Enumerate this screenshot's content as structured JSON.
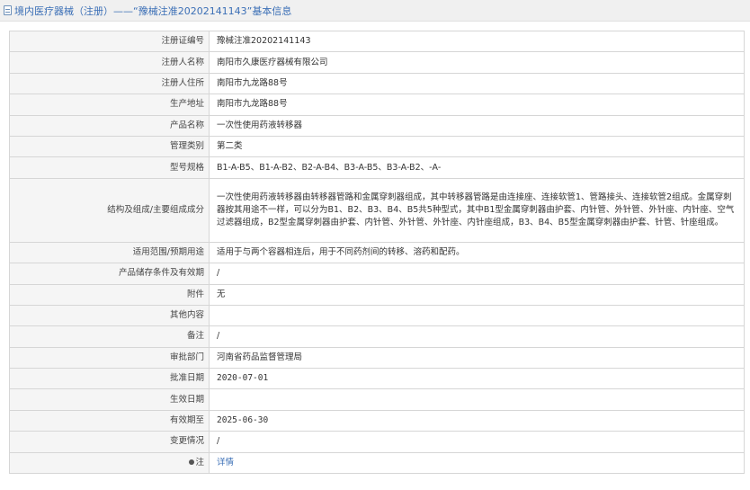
{
  "header": {
    "title": "境内医疗器械（注册）——“豫械注准20202141143”基本信息"
  },
  "rows": [
    {
      "label": "注册证编号",
      "value": "豫械注准20202141143"
    },
    {
      "label": "注册人名称",
      "value": "南阳市久康医疗器械有限公司"
    },
    {
      "label": "注册人住所",
      "value": "南阳市九龙路88号"
    },
    {
      "label": "生产地址",
      "value": "南阳市九龙路88号"
    },
    {
      "label": "产品名称",
      "value": "一次性使用药液转移器"
    },
    {
      "label": "管理类别",
      "value": "第二类"
    },
    {
      "label": "型号规格",
      "value": "B1-A-B5、B1-A-B2、B2-A-B4、B3-A-B5、B3-A-B2、-A-"
    },
    {
      "label": "结构及组成/主要组成成分",
      "value": "一次性使用药液转移器由转移器管路和金属穿刺器组成，其中转移器管路是由连接座、连接软管1、管路接头、连接软管2组成。金属穿刺器按其用途不一样，可以分为B1、B2、B3、B4、B5共5种型式，其中B1型金属穿刺器由护套、内针管、外针管、外针座、内针座、空气过滤器组成，B2型金属穿刺器由护套、内针管、外针管、外针座、内针座组成，B3、B4、B5型金属穿刺器由护套、针管、针座组成。"
    },
    {
      "label": "适用范围/预期用途",
      "value": "适用于与两个容器相连后，用于不同药剂间的转移、溶药和配药。"
    },
    {
      "label": "产品储存条件及有效期",
      "value": "/"
    },
    {
      "label": "附件",
      "value": "无"
    },
    {
      "label": "其他内容",
      "value": ""
    },
    {
      "label": "备注",
      "value": "/"
    },
    {
      "label": "审批部门",
      "value": "河南省药品监督管理局"
    },
    {
      "label": "批准日期",
      "value": "2020-07-01"
    },
    {
      "label": "生效日期",
      "value": ""
    },
    {
      "label": "有效期至",
      "value": "2025-06-30"
    },
    {
      "label": "变更情况",
      "value": "/"
    },
    {
      "label": "注",
      "value": "详情"
    }
  ]
}
